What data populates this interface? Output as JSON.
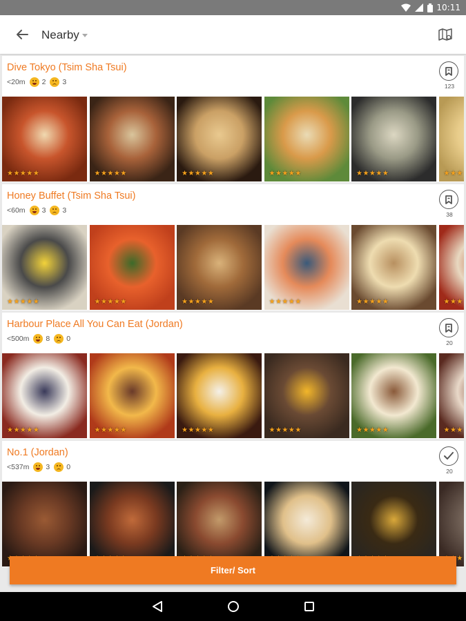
{
  "status": {
    "time": "10:11"
  },
  "header": {
    "title": "Nearby"
  },
  "restaurants": [
    {
      "name": "Dive Tokyo (Tsim Sha Tsui)",
      "distance": "<20m",
      "smile": "2",
      "cry": "3",
      "count": "123",
      "saved": false,
      "photos": [
        {
          "stars": "★★★★★",
          "colors": [
            "#7a2a10",
            "#c8552c",
            "#f0d9b0"
          ]
        },
        {
          "stars": "★★★★★",
          "colors": [
            "#3a2416",
            "#a8623a",
            "#d9c59c"
          ]
        },
        {
          "stars": "★★★★★",
          "colors": [
            "#2a1a10",
            "#caa065",
            "#e9c98f"
          ]
        },
        {
          "stars": "★★★★★",
          "colors": [
            "#5e8a3a",
            "#d99a4a",
            "#eadbb5"
          ]
        },
        {
          "stars": "★★★★★",
          "colors": [
            "#2c2c2c",
            "#9a9a86",
            "#dcd7c2"
          ]
        },
        {
          "stars": "★★★",
          "colors": [
            "#b89a55",
            "#e8cc8a",
            "#f4e3b5"
          ]
        }
      ]
    },
    {
      "name": "Honey Buffet (Tsim Sha Tsui)",
      "distance": "<60m",
      "smile": "3",
      "cry": "3",
      "count": "38",
      "saved": false,
      "photos": [
        {
          "stars": "★★★★★",
          "colors": [
            "#d9d2c2",
            "#4a4a4a",
            "#f2d23a"
          ]
        },
        {
          "stars": "★★★★★",
          "colors": [
            "#c0401c",
            "#e8612c",
            "#3c6a2a"
          ]
        },
        {
          "stars": "★★★★★",
          "colors": [
            "#5a3a24",
            "#a06a3a",
            "#d9b27a"
          ]
        },
        {
          "stars": "★★★★★",
          "colors": [
            "#e9dfd2",
            "#e58a5a",
            "#3a5a7a"
          ]
        },
        {
          "stars": "★★★★★",
          "colors": [
            "#6a4a30",
            "#eedcb0",
            "#b89060"
          ]
        },
        {
          "stars": "★★★",
          "colors": [
            "#a02a1a",
            "#e8d8c0",
            "#c05a3a"
          ]
        }
      ]
    },
    {
      "name": "Harbour Place All You Can Eat  (Jordan)",
      "distance": "<500m",
      "smile": "8",
      "cry": "0",
      "count": "20",
      "saved": false,
      "photos": [
        {
          "stars": "★★★★★",
          "colors": [
            "#8a2a20",
            "#f2ede4",
            "#3a3a5a"
          ]
        },
        {
          "stars": "★★★★★",
          "colors": [
            "#b03a1a",
            "#f2b84a",
            "#6a3a2a"
          ]
        },
        {
          "stars": "★★★★★",
          "colors": [
            "#3a1a10",
            "#e8b040",
            "#f4f0e8"
          ]
        },
        {
          "stars": "★★★★★",
          "colors": [
            "#3a2a20",
            "#6a4a34",
            "#f2b62a"
          ]
        },
        {
          "stars": "★★★★★",
          "colors": [
            "#4a6a2a",
            "#f2e8d0",
            "#8a5a3a"
          ]
        },
        {
          "stars": "★★★",
          "colors": [
            "#5a2a20",
            "#e8d8c8",
            "#7a3a2a"
          ]
        }
      ]
    },
    {
      "name": "No.1 (Jordan)",
      "distance": "<537m",
      "smile": "3",
      "cry": "0",
      "count": "20",
      "saved": true,
      "photos": [
        {
          "stars": "★★★★★",
          "colors": [
            "#2a1a14",
            "#6a3a24",
            "#9a5a34"
          ]
        },
        {
          "stars": "★★★★★",
          "colors": [
            "#1a1a1a",
            "#7a3a20",
            "#c06a3a"
          ]
        },
        {
          "stars": "★★★★★",
          "colors": [
            "#2a2016",
            "#8a4a30",
            "#c29a6a"
          ]
        },
        {
          "stars": "★★★★★",
          "colors": [
            "#10151a",
            "#e0c08a",
            "#f4ead8"
          ]
        },
        {
          "stars": "★★★★★",
          "colors": [
            "#2a2620",
            "#3a2a14",
            "#d9a83a"
          ]
        },
        {
          "stars": "★★★",
          "colors": [
            "#3a2a24",
            "#6a5a50",
            "#9a8a7a"
          ]
        }
      ]
    }
  ],
  "filter": {
    "label": "Filter/ Sort"
  },
  "colors": {
    "accent": "#ef7a22",
    "star": "#f5a11c"
  },
  "icons": {
    "back": "arrow-left-icon",
    "map": "map-icon",
    "save": "bookmark-icon",
    "saved": "check-icon"
  }
}
